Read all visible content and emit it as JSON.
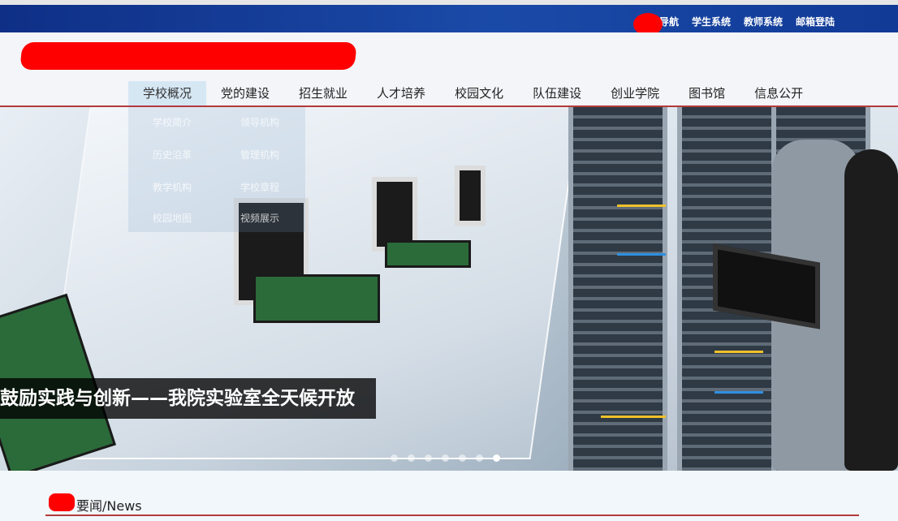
{
  "top_links": [
    "导航",
    "学生系统",
    "教师系统",
    "邮箱登陆"
  ],
  "nav": [
    "学校概况",
    "党的建设",
    "招生就业",
    "人才培养",
    "校园文化",
    "队伍建设",
    "创业学院",
    "图书馆",
    "信息公开"
  ],
  "dropdown_items": [
    "学校简介",
    "领导机构",
    "管理机构",
    "教学机构",
    "校园地图",
    "视频展示",
    "历史沿革",
    "学校章程"
  ],
  "caption": "鼓励实践与创新——我院实验室全天候开放",
  "news": {
    "title": "要闻/News"
  },
  "colors": {
    "top_bar": "#1a4aa8",
    "accent_rule": "#b23a3a",
    "nav_active_bg": "#d6e7f4",
    "redaction": "#ff0000"
  }
}
